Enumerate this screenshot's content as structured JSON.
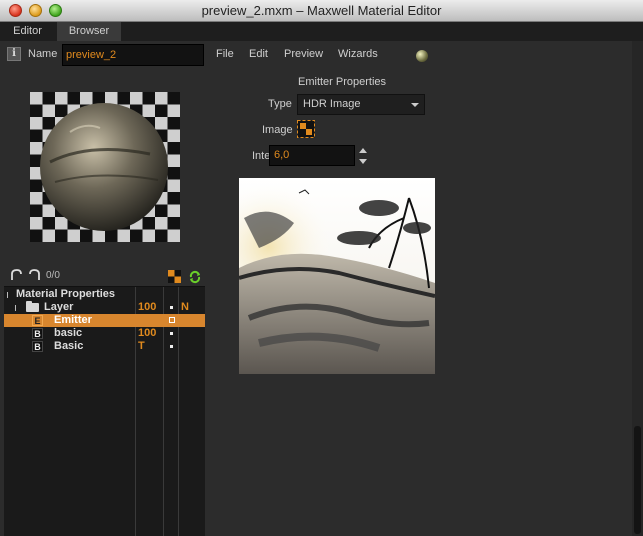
{
  "window": {
    "title": "preview_2.mxm – Maxwell Material Editor"
  },
  "tabs": [
    {
      "label": "Editor"
    },
    {
      "label": "Browser"
    }
  ],
  "header": {
    "info_glyph": "i",
    "name_label": "Name",
    "name_value": "preview_2",
    "menu": [
      "File",
      "Edit",
      "Preview",
      "Wizards"
    ]
  },
  "toolbar": {
    "counter": "0/0"
  },
  "tree": {
    "rows": [
      {
        "label": "Material Properties",
        "value": "",
        "flag": "",
        "mark": ""
      },
      {
        "label": "Layer",
        "value": "100",
        "flag": "N",
        "mark": "dot"
      },
      {
        "label": "Emitter",
        "badge": "E",
        "value": "",
        "flag": "",
        "mark": "square",
        "selected": true
      },
      {
        "label": "basic",
        "badge": "B",
        "value": "100",
        "flag": "",
        "mark": "dot"
      },
      {
        "label": "Basic",
        "badge": "B",
        "value": "T",
        "flag": "",
        "mark": "dot"
      }
    ]
  },
  "emitter": {
    "title": "Emitter Properties",
    "type_label": "Type",
    "type_value": "HDR Image",
    "image_label": "Image",
    "intensity_label": "Intensity",
    "intensity_value": "6,0"
  },
  "colors": {
    "accent": "#d8862e",
    "value_text": "#e08a1e",
    "background": "#2c2c2c",
    "tree_bg": "#1a1a1a"
  }
}
